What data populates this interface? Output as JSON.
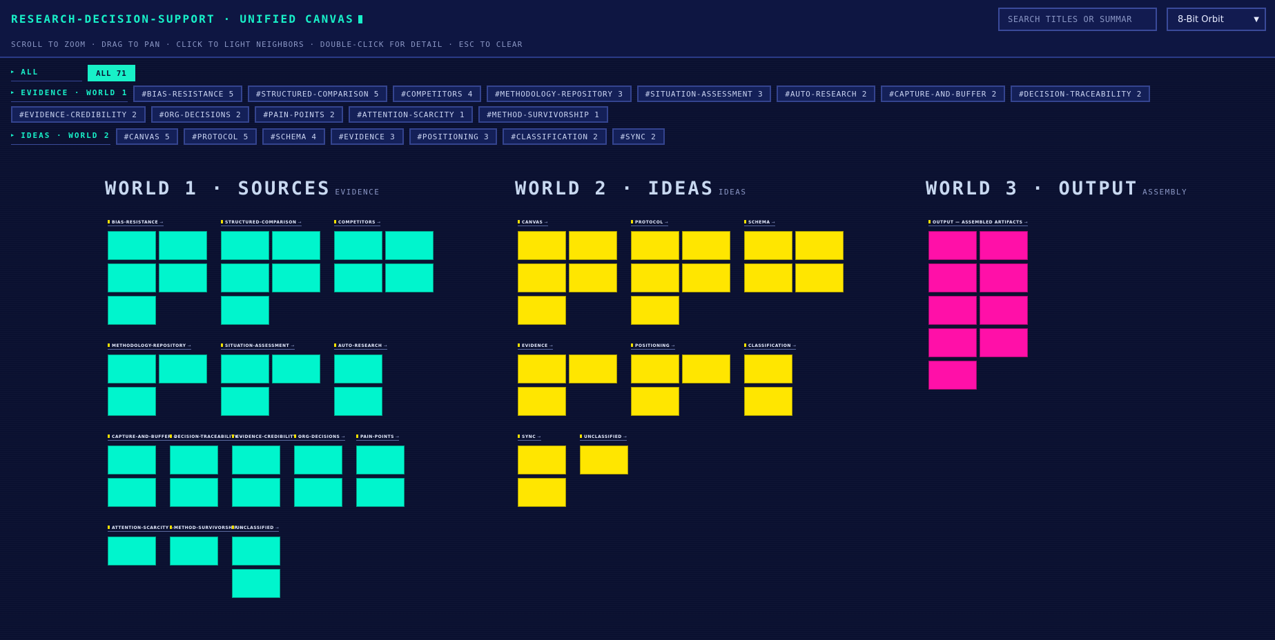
{
  "header": {
    "title": "RESEARCH-DECISION-SUPPORT · UNIFIED CANVAS",
    "hint": "SCROLL TO ZOOM · DRAG TO PAN · CLICK TO LIGHT NEIGHBORS · DOUBLE-CLICK FOR DETAIL · ESC TO CLEAR",
    "search_placeholder": "SEARCH TITLES OR SUMMAR",
    "theme_selected": "8-Bit Orbit"
  },
  "filters": {
    "all_label": "ALL",
    "all_chip": "ALL 71",
    "evidence_label": "EVIDENCE · WORLD 1",
    "evidence_chips": [
      "#BIAS-RESISTANCE 5",
      "#STRUCTURED-COMPARISON 5",
      "#COMPETITORS 4",
      "#METHODOLOGY-REPOSITORY 3",
      "#SITUATION-ASSESSMENT 3",
      "#AUTO-RESEARCH 2",
      "#CAPTURE-AND-BUFFER 2",
      "#DECISION-TRACEABILITY 2",
      "#EVIDENCE-CREDIBILITY 2",
      "#ORG-DECISIONS 2",
      "#PAIN-POINTS 2",
      "#ATTENTION-SCARCITY 1",
      "#METHOD-SURVIVORSHIP 1"
    ],
    "ideas_label": "IDEAS · WORLD 2",
    "ideas_chips": [
      "#CANVAS 5",
      "#PROTOCOL 5",
      "#SCHEMA 4",
      "#EVIDENCE 3",
      "#POSITIONING 3",
      "#CLASSIFICATION 2",
      "#SYNC 2"
    ]
  },
  "colors": {
    "evidence": "#00f5cd",
    "ideas": "#ffe600",
    "output": "#ff10a8",
    "accent": "#18f0c8"
  },
  "worlds": [
    {
      "title": "WORLD 1 · SOURCES",
      "sub": "EVIDENCE"
    },
    {
      "title": "WORLD 2 · IDEAS",
      "sub": "IDEAS"
    },
    {
      "title": "WORLD 3 · OUTPUT",
      "sub": "ASSEMBLY"
    }
  ],
  "clusters": {
    "w1": [
      {
        "label": "BIAS-RESISTANCE",
        "count": 5
      },
      {
        "label": "STRUCTURED-COMPARISON",
        "count": 5
      },
      {
        "label": "COMPETITORS",
        "count": 4
      },
      {
        "label": "METHODOLOGY-REPOSITORY",
        "count": 3
      },
      {
        "label": "SITUATION-ASSESSMENT",
        "count": 3
      },
      {
        "label": "AUTO-RESEARCH",
        "count": 2
      },
      {
        "label": "CAPTURE-AND-BUFFER",
        "count": 2
      },
      {
        "label": "DECISION-TRACEABILITY",
        "count": 2
      },
      {
        "label": "EVIDENCE-CREDIBILITY",
        "count": 2
      },
      {
        "label": "ORG-DECISIONS",
        "count": 2
      },
      {
        "label": "PAIN-POINTS",
        "count": 2
      },
      {
        "label": "ATTENTION-SCARCITY",
        "count": 1
      },
      {
        "label": "METHOD-SURVIVORSHIP",
        "count": 1
      },
      {
        "label": "UNCLASSIFIED",
        "count": 2
      }
    ],
    "w2": [
      {
        "label": "CANVAS",
        "count": 5
      },
      {
        "label": "PROTOCOL",
        "count": 5
      },
      {
        "label": "SCHEMA",
        "count": 4
      },
      {
        "label": "EVIDENCE",
        "count": 3
      },
      {
        "label": "POSITIONING",
        "count": 3
      },
      {
        "label": "CLASSIFICATION",
        "count": 2
      },
      {
        "label": "SYNC",
        "count": 2
      },
      {
        "label": "UNCLASSIFIED",
        "count": 1
      }
    ],
    "w3": [
      {
        "label": "OUTPUT — ASSEMBLED ARTIFACTS",
        "count": 9
      }
    ]
  },
  "arrow": "→"
}
